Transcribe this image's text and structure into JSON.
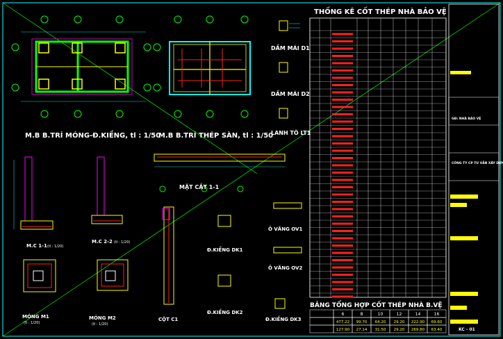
{
  "drawing_titles": {
    "foundation_plan": "M.B B.TRÍ MÓNG-Đ.KIỀNG, tl : 1/50",
    "slab_plan": "M.B B.TRÍ THÉP SÀN, tl : 1/50",
    "beam_d1": "DẦM MÁI D1",
    "beam_d2": "DẦM MÁI D2",
    "lintel": "LANH TÔ LT1",
    "section_1_1": "MẶT CẮT 1-1",
    "m_c_1": "M.C 1-1",
    "m_c_1_scale": "(tl : 1/20)",
    "m_c_2": "M.C 2-2",
    "m_c_2_scale": "(tl : 1/20)",
    "footing_m1": "MÓNG M1",
    "footing_m1_scale": "(tl : 1/20)",
    "footing_m2": "MÓNG M2",
    "footing_m2_scale": "(tl : 1/20)",
    "column_c1": "CỘT C1",
    "beam_dk1": "Đ.KIỀNG DK1",
    "beam_dk2": "Đ.KIỀNG DK2",
    "beam_dk3": "Đ.KIỀNG DK3",
    "eave_ov1": "Ô VĂNG OV1",
    "eave_ov2": "Ô VĂNG OV2"
  },
  "rebar_schedule": {
    "title": "THỐNG KÊ CỐT THÉP NHÀ BẢO VỆ"
  },
  "summary_table": {
    "title": "BẢNG TỔNG HỢP CỐT THÉP NHÀ B.VỆ",
    "headers": [
      "",
      "6",
      "8",
      "10",
      "12",
      "14",
      "16"
    ],
    "rows": [
      [
        "",
        "477.22",
        "99.70",
        "64.20",
        "29.20",
        "222.90",
        "69.60"
      ],
      [
        "",
        "127.90",
        "27.14",
        "31.50",
        "29.20",
        "269.80",
        "63.40"
      ]
    ]
  },
  "title_block": {
    "company": "CÔNG TY CP TƯ VẤN XÂY DỰNG M.X.D",
    "project_note": "GĐ: NHÀ BẢO VỆ",
    "drawing_no": "KC - 01"
  },
  "colors": {
    "grid": "#00ffff",
    "foundation": "#00ff00",
    "rebar": "#ff2020",
    "beam": "#ffff00",
    "dim": "#00e0e0"
  }
}
